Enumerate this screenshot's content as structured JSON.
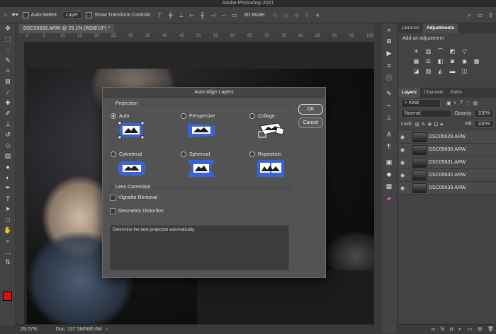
{
  "app": {
    "window_title": "Adobe Photoshop 2021"
  },
  "options_bar": {
    "auto_select_label": "Auto-Select:",
    "auto_select_value": "Layer",
    "show_transform_label": "Show Transform Controls",
    "mode_3d_label": "3D Mode:"
  },
  "document": {
    "tab_title": "DSC05633.ARW @ 29.1% (RGB/16*) *"
  },
  "ruler_ticks": [
    "0",
    "5",
    "10",
    "15",
    "20",
    "25",
    "30",
    "35",
    "40",
    "45",
    "50",
    "55",
    "60",
    "65",
    "70",
    "75",
    "80",
    "85",
    "90",
    "95",
    "100"
  ],
  "status_bar": {
    "zoom": "29.07%",
    "doc_info": "Doc: 137.3M/686.6M"
  },
  "panels": {
    "top_tabs": [
      "Libraries",
      "Adjustments"
    ],
    "adjustments_hint": "Add an adjustment",
    "layer_tabs": [
      "Layers",
      "Channels",
      "Paths"
    ],
    "filter_kind": "Kind",
    "blend_mode": "Normal",
    "opacity_label": "Opacity:",
    "opacity_value": "100%",
    "lock_label": "Lock:",
    "fill_label": "Fill:",
    "fill_value": "100%",
    "layers": [
      {
        "name": "DSC05629.ARW"
      },
      {
        "name": "DSC05630.ARW"
      },
      {
        "name": "DSC05631.ARW"
      },
      {
        "name": "DSC05632.ARW"
      },
      {
        "name": "DSC05633.ARW"
      }
    ]
  },
  "dialog": {
    "title": "Auto-Align Layers",
    "projection_label": "Projection",
    "options": [
      "Auto",
      "Perspective",
      "Collage",
      "Cylindrical",
      "Spherical",
      "Reposition"
    ],
    "selected_option": "Auto",
    "lens_correction_label": "Lens Correction",
    "vignette_label": "Vignette Removal",
    "geometric_label": "Geometric Distortion",
    "ok_label": "OK",
    "cancel_label": "Cancel",
    "description": "Determine the best projection automatically."
  },
  "colors": {
    "foreground": "#e00d0d",
    "projection_icon_blue": "#3a63d8"
  },
  "icons": [
    "move-icon",
    "marquee-icon",
    "lasso-icon",
    "quick-select-icon",
    "crop-icon",
    "eyedropper-icon",
    "healing-icon",
    "brush-icon",
    "stamp-icon",
    "history-brush-icon",
    "eraser-icon",
    "gradient-icon",
    "blur-icon",
    "dodge-icon",
    "pen-icon",
    "type-icon",
    "path-select-icon",
    "rectangle-icon",
    "hand-icon",
    "zoom-icon"
  ]
}
